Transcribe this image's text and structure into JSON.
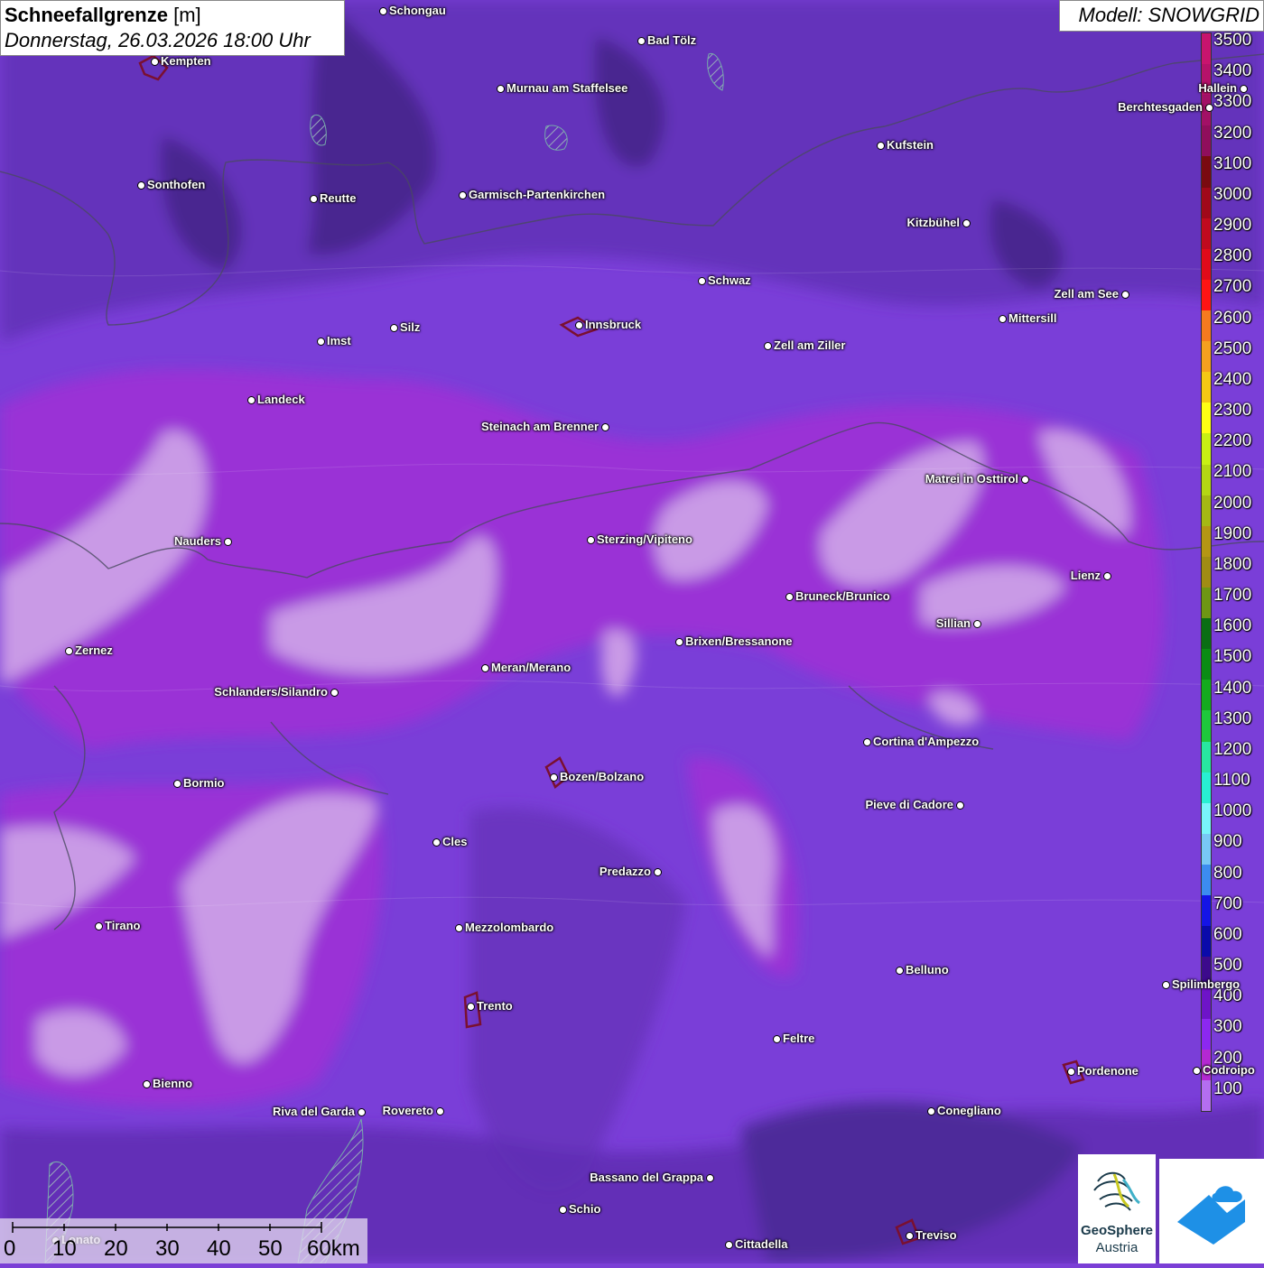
{
  "title": {
    "name": "Schneefallgrenze",
    "unit": "[m]",
    "datetime": "Donnerstag, 26.03.2026 18:00 Uhr"
  },
  "model": "Modell: SNOWGRID",
  "legend": {
    "labels": [
      "3500",
      "3400",
      "3300",
      "3200",
      "3100",
      "3000",
      "2900",
      "2800",
      "2700",
      "2600",
      "2500",
      "2400",
      "2300",
      "2200",
      "2100",
      "2000",
      "1900",
      "1800",
      "1700",
      "1600",
      "1500",
      "1400",
      "1300",
      "1200",
      "1100",
      "1000",
      "900",
      "800",
      "700",
      "600",
      "500",
      "400",
      "300",
      "200",
      "100"
    ],
    "colors": [
      "#c8146e",
      "#b5126a",
      "#a21066",
      "#900e5c",
      "#7a0a10",
      "#a0081a",
      "#c00a1e",
      "#e00a1a",
      "#ff1414",
      "#f57a1e",
      "#f5a01e",
      "#f5c814",
      "#ffff14",
      "#c8f014",
      "#b4d614",
      "#a5b814",
      "#b49614",
      "#a08c14",
      "#6e9614",
      "#0a6e14",
      "#0a8c14",
      "#14aa1e",
      "#1ec83c",
      "#28e6a0",
      "#28f0d2",
      "#78f5fa",
      "#78c8f5",
      "#3c8cf0",
      "#1414e6",
      "#0a0aaa",
      "#3c0a8c",
      "#6e14c8",
      "#8c28f0",
      "#b428d2",
      "#b46ef0"
    ]
  },
  "cities": [
    {
      "name": "Schongau"
    },
    {
      "name": "Bad Tölz"
    },
    {
      "name": "Kempten"
    },
    {
      "name": "Murnau am Staffelsee"
    },
    {
      "name": "Kufstein"
    },
    {
      "name": "Berchtesgaden"
    },
    {
      "name": "Hallein"
    },
    {
      "name": "Sonthofen"
    },
    {
      "name": "Reutte"
    },
    {
      "name": "Garmisch-Partenkirchen"
    },
    {
      "name": "Kitzbühel"
    },
    {
      "name": "Schwaz"
    },
    {
      "name": "Zell am See"
    },
    {
      "name": "Mittersill"
    },
    {
      "name": "Silz"
    },
    {
      "name": "Innsbruck"
    },
    {
      "name": "Imst"
    },
    {
      "name": "Zell am Ziller"
    },
    {
      "name": "Landeck"
    },
    {
      "name": "Steinach am Brenner"
    },
    {
      "name": "Matrei in Osttirol"
    },
    {
      "name": "Nauders"
    },
    {
      "name": "Sterzing/Vipiteno"
    },
    {
      "name": "Lienz"
    },
    {
      "name": "Bruneck/Brunico"
    },
    {
      "name": "Sillian"
    },
    {
      "name": "Brixen/Bressanone"
    },
    {
      "name": "Zernez"
    },
    {
      "name": "Meran/Merano"
    },
    {
      "name": "Schlanders/Silandro"
    },
    {
      "name": "Cortina d'Ampezzo"
    },
    {
      "name": "Bormio"
    },
    {
      "name": "Bozen/Bolzano"
    },
    {
      "name": "Pieve di Cadore"
    },
    {
      "name": "Cles"
    },
    {
      "name": "Predazzo"
    },
    {
      "name": "Tirano"
    },
    {
      "name": "Mezzolombardo"
    },
    {
      "name": "Belluno"
    },
    {
      "name": "Spilimbergo"
    },
    {
      "name": "Trento"
    },
    {
      "name": "Feltre"
    },
    {
      "name": "Bienno"
    },
    {
      "name": "Pordenone"
    },
    {
      "name": "Riva del Garda"
    },
    {
      "name": "Rovereto"
    },
    {
      "name": "Conegliano"
    },
    {
      "name": "Bassano del Grappa"
    },
    {
      "name": "Schio"
    },
    {
      "name": "Lonato"
    },
    {
      "name": "Treviso"
    },
    {
      "name": "Cittadella"
    },
    {
      "name": "Codroipo"
    }
  ],
  "scale": {
    "labels": [
      "0",
      "10",
      "20",
      "30",
      "40",
      "50",
      "60km"
    ]
  },
  "logo": {
    "line1": "GeoSphere",
    "line2": "Austria"
  }
}
